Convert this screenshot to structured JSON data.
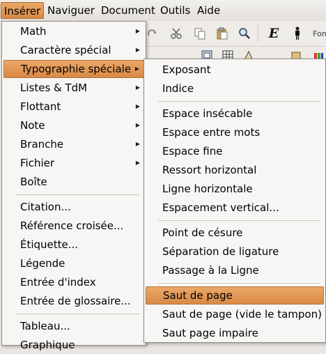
{
  "menubar": {
    "items": [
      {
        "label": "Insérer",
        "active": true
      },
      {
        "label": "Naviguer",
        "active": false
      },
      {
        "label": "Document",
        "active": false
      },
      {
        "label": "Outils",
        "active": false
      },
      {
        "label": "Aide",
        "active": false
      }
    ]
  },
  "toolbar": {
    "icons": [
      "redo-icon",
      "cut-icon",
      "copy-icon",
      "paste-icon",
      "find-replace-icon",
      "emphasis-icon",
      "person-icon"
    ],
    "font_label": "Fon"
  },
  "insert_menu": {
    "items": [
      {
        "label": "Math",
        "has_submenu": true
      },
      {
        "label": "Caractère spécial",
        "has_submenu": true
      },
      {
        "label": "Typographie spéciale",
        "has_submenu": true,
        "highlighted": true
      },
      {
        "label": "Listes & TdM",
        "has_submenu": true
      },
      {
        "label": "Flottant",
        "has_submenu": true
      },
      {
        "label": "Note",
        "has_submenu": true
      },
      {
        "label": "Branche",
        "has_submenu": true
      },
      {
        "label": "Fichier",
        "has_submenu": true
      },
      {
        "label": "Boîte",
        "has_submenu": false
      },
      {
        "label": "Citation...",
        "has_submenu": false
      },
      {
        "label": "Référence croisée...",
        "has_submenu": false
      },
      {
        "label": "Étiquette...",
        "has_submenu": false
      },
      {
        "label": "Légende",
        "has_submenu": false
      },
      {
        "label": "Entrée d'index",
        "has_submenu": false
      },
      {
        "label": "Entrée de glossaire...",
        "has_submenu": false
      },
      {
        "label": "Tableau...",
        "has_submenu": false
      },
      {
        "label": "Graphique",
        "has_submenu": false
      }
    ]
  },
  "typo_submenu": {
    "items": [
      {
        "label": "Exposant"
      },
      {
        "label": "Indice"
      },
      {
        "label": "Espace insécable"
      },
      {
        "label": "Espace entre mots"
      },
      {
        "label": "Espace fine"
      },
      {
        "label": "Ressort horizontal"
      },
      {
        "label": "Ligne horizontale"
      },
      {
        "label": "Espacement vertical..."
      },
      {
        "label": "Point de césure"
      },
      {
        "label": "Séparation de ligature"
      },
      {
        "label": "Passage à la Ligne"
      },
      {
        "label": "Saut de page",
        "highlighted": true
      },
      {
        "label": "Saut de page (vide le tampon)"
      },
      {
        "label": "Saut page impaire"
      }
    ]
  },
  "colors": {
    "highlight": "#e09a55",
    "menu_bg": "#f7f6f4",
    "menubar_bg": "#ebe8e3"
  }
}
